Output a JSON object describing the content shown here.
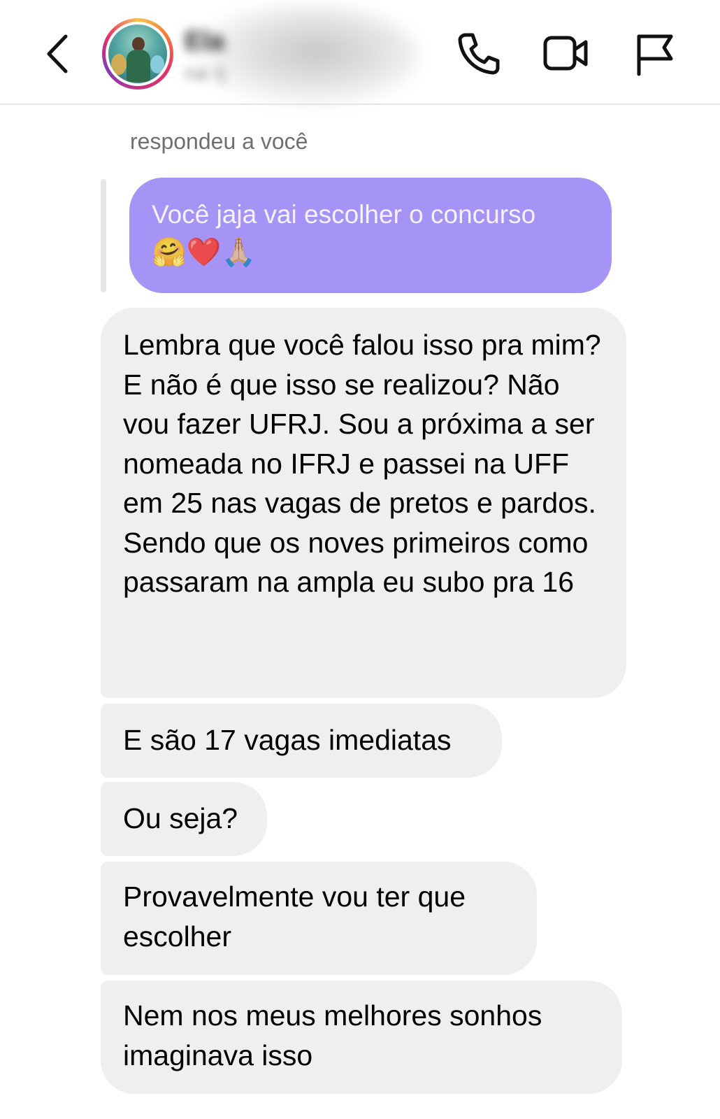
{
  "header": {
    "contact_name": "Ela",
    "contact_username": "na rj",
    "icons": [
      "back-chevron-icon",
      "phone-icon",
      "video-icon",
      "flag-icon"
    ]
  },
  "reply": {
    "label": "respondeu a você",
    "original_text": "Você jaja vai escolher o concurso",
    "original_emojis": "🤗❤️🙏🏼"
  },
  "messages": [
    {
      "text": "Lembra que você falou isso pra mim? E não é que isso se realizou? Não vou fazer UFRJ. Sou a próxima a ser nomeada no IFRJ e passei na UFF  em 25 nas vagas de pretos e pardos. Sendo que os noves primeiros como passaram na ampla eu subo pra 16"
    },
    {
      "text": "E são 17 vagas imediatas"
    },
    {
      "text": "Ou seja?"
    },
    {
      "text": "Provavelmente vou ter que escolher"
    },
    {
      "text": "Nem nos meus melhores sonhos imaginava isso"
    }
  ],
  "colors": {
    "replied_bubble": "#a594f5",
    "received_bubble": "#efefef",
    "header_border": "#e6e6e6",
    "muted_text": "#6f6f6f"
  }
}
